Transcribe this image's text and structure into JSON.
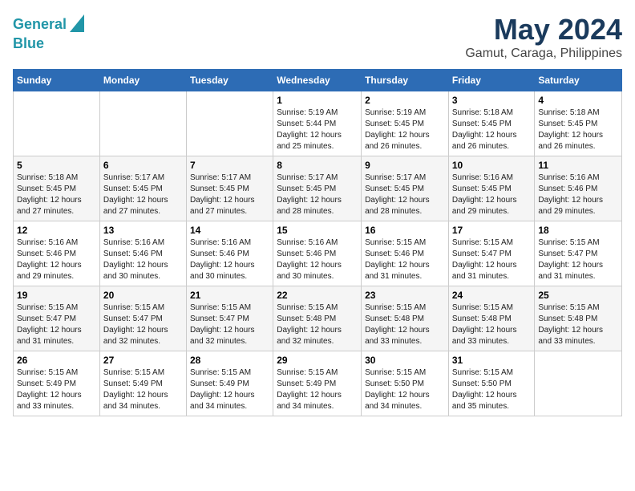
{
  "logo": {
    "line1": "General",
    "line2": "Blue"
  },
  "title": "May 2024",
  "subtitle": "Gamut, Caraga, Philippines",
  "days_header": [
    "Sunday",
    "Monday",
    "Tuesday",
    "Wednesday",
    "Thursday",
    "Friday",
    "Saturday"
  ],
  "weeks": [
    [
      {
        "day": "",
        "info": ""
      },
      {
        "day": "",
        "info": ""
      },
      {
        "day": "",
        "info": ""
      },
      {
        "day": "1",
        "info": "Sunrise: 5:19 AM\nSunset: 5:44 PM\nDaylight: 12 hours\nand 25 minutes."
      },
      {
        "day": "2",
        "info": "Sunrise: 5:19 AM\nSunset: 5:45 PM\nDaylight: 12 hours\nand 26 minutes."
      },
      {
        "day": "3",
        "info": "Sunrise: 5:18 AM\nSunset: 5:45 PM\nDaylight: 12 hours\nand 26 minutes."
      },
      {
        "day": "4",
        "info": "Sunrise: 5:18 AM\nSunset: 5:45 PM\nDaylight: 12 hours\nand 26 minutes."
      }
    ],
    [
      {
        "day": "5",
        "info": "Sunrise: 5:18 AM\nSunset: 5:45 PM\nDaylight: 12 hours\nand 27 minutes."
      },
      {
        "day": "6",
        "info": "Sunrise: 5:17 AM\nSunset: 5:45 PM\nDaylight: 12 hours\nand 27 minutes."
      },
      {
        "day": "7",
        "info": "Sunrise: 5:17 AM\nSunset: 5:45 PM\nDaylight: 12 hours\nand 27 minutes."
      },
      {
        "day": "8",
        "info": "Sunrise: 5:17 AM\nSunset: 5:45 PM\nDaylight: 12 hours\nand 28 minutes."
      },
      {
        "day": "9",
        "info": "Sunrise: 5:17 AM\nSunset: 5:45 PM\nDaylight: 12 hours\nand 28 minutes."
      },
      {
        "day": "10",
        "info": "Sunrise: 5:16 AM\nSunset: 5:45 PM\nDaylight: 12 hours\nand 29 minutes."
      },
      {
        "day": "11",
        "info": "Sunrise: 5:16 AM\nSunset: 5:46 PM\nDaylight: 12 hours\nand 29 minutes."
      }
    ],
    [
      {
        "day": "12",
        "info": "Sunrise: 5:16 AM\nSunset: 5:46 PM\nDaylight: 12 hours\nand 29 minutes."
      },
      {
        "day": "13",
        "info": "Sunrise: 5:16 AM\nSunset: 5:46 PM\nDaylight: 12 hours\nand 30 minutes."
      },
      {
        "day": "14",
        "info": "Sunrise: 5:16 AM\nSunset: 5:46 PM\nDaylight: 12 hours\nand 30 minutes."
      },
      {
        "day": "15",
        "info": "Sunrise: 5:16 AM\nSunset: 5:46 PM\nDaylight: 12 hours\nand 30 minutes."
      },
      {
        "day": "16",
        "info": "Sunrise: 5:15 AM\nSunset: 5:46 PM\nDaylight: 12 hours\nand 31 minutes."
      },
      {
        "day": "17",
        "info": "Sunrise: 5:15 AM\nSunset: 5:47 PM\nDaylight: 12 hours\nand 31 minutes."
      },
      {
        "day": "18",
        "info": "Sunrise: 5:15 AM\nSunset: 5:47 PM\nDaylight: 12 hours\nand 31 minutes."
      }
    ],
    [
      {
        "day": "19",
        "info": "Sunrise: 5:15 AM\nSunset: 5:47 PM\nDaylight: 12 hours\nand 31 minutes."
      },
      {
        "day": "20",
        "info": "Sunrise: 5:15 AM\nSunset: 5:47 PM\nDaylight: 12 hours\nand 32 minutes."
      },
      {
        "day": "21",
        "info": "Sunrise: 5:15 AM\nSunset: 5:47 PM\nDaylight: 12 hours\nand 32 minutes."
      },
      {
        "day": "22",
        "info": "Sunrise: 5:15 AM\nSunset: 5:48 PM\nDaylight: 12 hours\nand 32 minutes."
      },
      {
        "day": "23",
        "info": "Sunrise: 5:15 AM\nSunset: 5:48 PM\nDaylight: 12 hours\nand 33 minutes."
      },
      {
        "day": "24",
        "info": "Sunrise: 5:15 AM\nSunset: 5:48 PM\nDaylight: 12 hours\nand 33 minutes."
      },
      {
        "day": "25",
        "info": "Sunrise: 5:15 AM\nSunset: 5:48 PM\nDaylight: 12 hours\nand 33 minutes."
      }
    ],
    [
      {
        "day": "26",
        "info": "Sunrise: 5:15 AM\nSunset: 5:49 PM\nDaylight: 12 hours\nand 33 minutes."
      },
      {
        "day": "27",
        "info": "Sunrise: 5:15 AM\nSunset: 5:49 PM\nDaylight: 12 hours\nand 34 minutes."
      },
      {
        "day": "28",
        "info": "Sunrise: 5:15 AM\nSunset: 5:49 PM\nDaylight: 12 hours\nand 34 minutes."
      },
      {
        "day": "29",
        "info": "Sunrise: 5:15 AM\nSunset: 5:49 PM\nDaylight: 12 hours\nand 34 minutes."
      },
      {
        "day": "30",
        "info": "Sunrise: 5:15 AM\nSunset: 5:50 PM\nDaylight: 12 hours\nand 34 minutes."
      },
      {
        "day": "31",
        "info": "Sunrise: 5:15 AM\nSunset: 5:50 PM\nDaylight: 12 hours\nand 35 minutes."
      },
      {
        "day": "",
        "info": ""
      }
    ]
  ]
}
